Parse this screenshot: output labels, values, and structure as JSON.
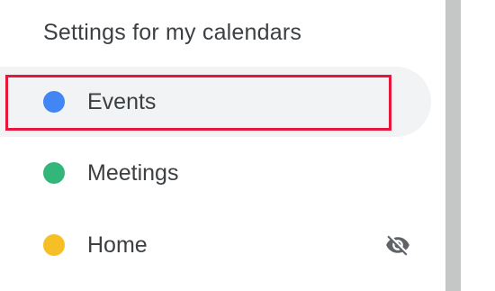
{
  "section": {
    "title": "Settings for my calendars"
  },
  "calendars": [
    {
      "label": "Events",
      "color": "#4285f4",
      "selected": true
    },
    {
      "label": "Meetings",
      "color": "#33b679",
      "selected": false
    },
    {
      "label": "Home",
      "color": "#f6bf26",
      "selected": false,
      "icon": "visibility-off-icon"
    }
  ],
  "colors": {
    "highlight_border": "#e8163a",
    "selected_bg": "#f1f3f4",
    "scrollbar": "#c4c7c5"
  }
}
